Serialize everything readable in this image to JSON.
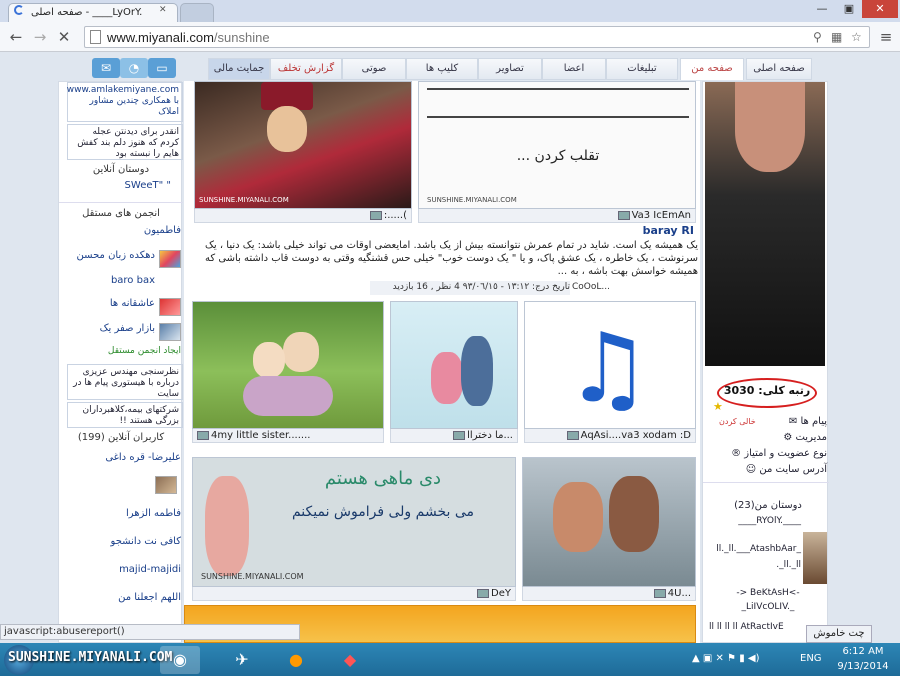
{
  "browser": {
    "tab_title": "صفحه اصلی - ____LyOrY.",
    "url_host": "www.miyanali.com",
    "url_path": "/sunshine",
    "window_min": "—",
    "window_max": "▣",
    "window_close": "✕"
  },
  "nav": {
    "tabs": [
      "صفحه اصلی",
      "صفحه من",
      "تبلیغات",
      "اعضا",
      "تصاویر",
      "کلیپ ها",
      "صوتی",
      "گزارش تخلف",
      "جمایت مالی"
    ]
  },
  "left": {
    "ad1": "www.amlakemiyane.com با همکاری چندین مشاور املاک",
    "ad2": "انقدر برای دیدنتن عجله کردم که هنوز دلم بند کفش هایم را نبسته بود",
    "friends_online_title": "دوستان آنلاین",
    "friend1": "SWeeT\" \"",
    "groups_title": "انجمن های مستقل",
    "groups": [
      "فاطمیون",
      "دهکده زبان محسن",
      "baro bax",
      "عاشقانه ها",
      "بازار صفر یک"
    ],
    "create_group": "ایجاد انجمن مستقل",
    "ad3": "نظرسنجی مهندس عزیزی درباره با هیستوری پیام ها در سایت",
    "ad4": "شرکتهای بیمه،کلاهبرداران بزرگی هستند !!",
    "online_users": "کاربران آنلاین (199)",
    "users": [
      "علیرضا- قره داغی",
      "فاطمه الزهرا",
      "کافی نت دانشجو",
      "majid-majidi",
      "اللهم اجعلنا من"
    ]
  },
  "center": {
    "cap1": ":.....(",
    "cap2": "Va3 IcEmAn",
    "author": "baray RI",
    "post": "یک همیشه یک است. شاید در تمام عمرش نتوانسته بیش از یک باشد. امایعضی اوقات می تواند خیلی باشد: یک دنیا ، یک سرنوشت ، یک خاطره ، یک عشق پاک، و یا \" یک دوست خوب\" خیلی حس قشنگیه وقتی به دوست قاب داشته باشی که همیشه خواسش بهت باشه ، به ...",
    "post_meta": "تاریخ درج: ١٣:١٢ - ٩٣/٠٦/١٥  4 نظر , 16 بازدید",
    "post_user": "CoOoL...",
    "cap3": "4my little sister.......",
    "cap4": "ما دختراا...",
    "cap5": "AqAsi....va3 xodam :D",
    "cap6": "DeY",
    "cap7": "4U...",
    "banner_line1": "دی ماهی هستم",
    "banner_line2": "می بخشم ولی فراموش نمیکنم",
    "watermark": "SUNSHINE.MIYANALI.COM",
    "cartoon_text": "... تقلب کردن"
  },
  "right": {
    "rank_label": "رتبه کلی:",
    "rank_value": "3030",
    "menu": [
      "پیام ها",
      "مدیریت",
      "نوع عضویت و امتیاز",
      "آدرس سایت من"
    ],
    "menu_side": "خالی کردن",
    "friends_title": "دوستان من(23)",
    "friends": [
      "____RYOlY.____",
      "ll._ll.___AtashbAar_",
      "._ll._ll",
      "-> BeKtAsH<-",
      "_LiIVcOLIV._",
      "ll ll ll ll AtRactIvE"
    ]
  },
  "chat": "چت خاموش",
  "status_url": "javascript:abusereport()",
  "taskbar": {
    "watermark": "SUNSHINE.MIYANALI.COM",
    "lang": "ENG",
    "time": "6:12 AM",
    "date": "9/13/2014"
  }
}
